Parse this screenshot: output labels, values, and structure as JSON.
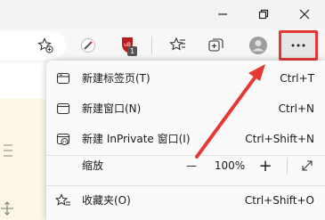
{
  "toolbar": {
    "extension_badge": "1"
  },
  "menu": {
    "new_tab": {
      "label": "新建标签页(T)",
      "shortcut": "Ctrl+T"
    },
    "new_window": {
      "label": "新建窗口(N)",
      "shortcut": "Ctrl+N"
    },
    "new_inprivate": {
      "label": "新建 InPrivate 窗口(I)",
      "shortcut": "Ctrl+Shift+N"
    },
    "zoom": {
      "label": "缩放",
      "minus": "—",
      "value": "100%",
      "plus": "+"
    },
    "favorites": {
      "label": "收藏夹(O)",
      "shortcut": "Ctrl+Shift+O"
    }
  },
  "colors": {
    "annotation": "#e53935",
    "accent": "#c0392b"
  }
}
